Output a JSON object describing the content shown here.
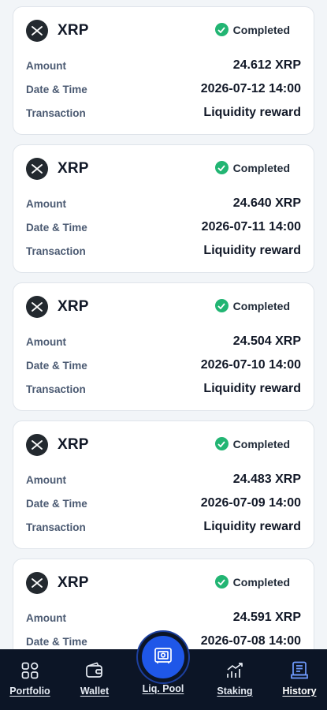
{
  "status_color": "#22b573",
  "accent_color": "#1f57e8",
  "labels": {
    "amount": "Amount",
    "datetime": "Date & Time",
    "transaction": "Transaction"
  },
  "transactions": [
    {
      "coin": "XRP",
      "icon": "xrp-icon",
      "status": "Completed",
      "amount": "24.612 XRP",
      "datetime": "2026-07-12 14:00",
      "type": "Liquidity reward"
    },
    {
      "coin": "XRP",
      "icon": "xrp-icon",
      "status": "Completed",
      "amount": "24.640 XRP",
      "datetime": "2026-07-11 14:00",
      "type": "Liquidity reward"
    },
    {
      "coin": "XRP",
      "icon": "xrp-icon",
      "status": "Completed",
      "amount": "24.504 XRP",
      "datetime": "2026-07-10 14:00",
      "type": "Liquidity reward"
    },
    {
      "coin": "XRP",
      "icon": "xrp-icon",
      "status": "Completed",
      "amount": "24.483 XRP",
      "datetime": "2026-07-09 14:00",
      "type": "Liquidity reward"
    },
    {
      "coin": "XRP",
      "icon": "xrp-icon",
      "status": "Completed",
      "amount": "24.591 XRP",
      "datetime": "2026-07-08 14:00",
      "type": "Liquidity reward"
    }
  ],
  "nav": {
    "portfolio": {
      "label": "Portfolio",
      "icon": "grid-icon"
    },
    "wallet": {
      "label": "Wallet",
      "icon": "wallet-icon"
    },
    "pool": {
      "label": "Liq. Pool",
      "icon": "safe-icon"
    },
    "staking": {
      "label": "Staking",
      "icon": "chart-up-icon"
    },
    "history": {
      "label": "History",
      "icon": "history-icon",
      "active": true
    }
  }
}
